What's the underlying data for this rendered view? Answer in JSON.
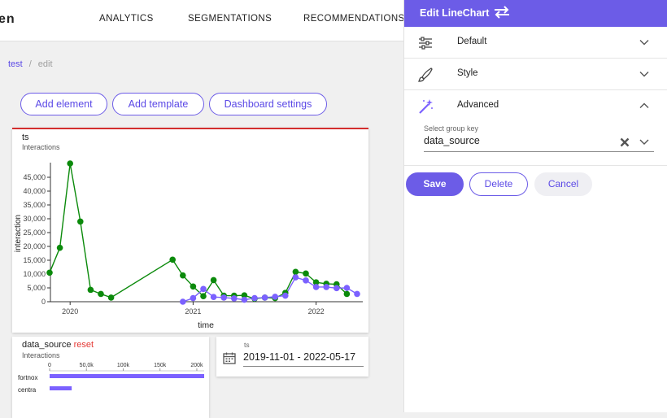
{
  "header": {
    "logo": "en",
    "nav": [
      "ANALYTICS",
      "SEGMENTATIONS",
      "RECOMMENDATIONS"
    ]
  },
  "breadcrumb": {
    "link": "test",
    "sep": "/",
    "current": "edit"
  },
  "toolbar": {
    "add_element": "Add element",
    "add_template": "Add template",
    "dashboard_settings": "Dashboard settings"
  },
  "main_chart": {
    "title": "ts",
    "subtitle": "Interactions",
    "border_color": "#d32f2f",
    "chart_data": {
      "type": "line",
      "xlabel": "time",
      "ylabel": "interaction",
      "ylim": [
        0,
        50000
      ],
      "y_ticks": [
        "0",
        "5,000",
        "10,000",
        "15,000",
        "20,000",
        "25,000",
        "30,000",
        "35,000",
        "40,000",
        "45,000"
      ],
      "x_ticks": [
        {
          "label": "2020",
          "x": "2020-01"
        },
        {
          "label": "2021",
          "x": "2021-01"
        },
        {
          "label": "2022",
          "x": "2022-01"
        }
      ],
      "series": [
        {
          "color": "#0b8a0b",
          "points": [
            [
              "2019-11",
              10500
            ],
            [
              "2019-12",
              19500
            ],
            [
              "2020-01",
              50000
            ],
            [
              "2020-02",
              29000
            ],
            [
              "2020-03",
              4300
            ],
            [
              "2020-04",
              2800
            ],
            [
              "2020-05",
              1500
            ],
            [
              "2020-11",
              15200
            ],
            [
              "2020-12",
              9500
            ],
            [
              "2021-01",
              5500
            ],
            [
              "2021-02",
              2000
            ],
            [
              "2021-03",
              7800
            ],
            [
              "2021-04",
              2200
            ],
            [
              "2021-05",
              2200
            ],
            [
              "2021-06",
              2300
            ],
            [
              "2021-07",
              1100
            ],
            [
              "2021-08",
              1500
            ],
            [
              "2021-09",
              1300
            ],
            [
              "2021-10",
              3200
            ],
            [
              "2021-11",
              10800
            ],
            [
              "2021-12",
              10200
            ],
            [
              "2022-01",
              7000
            ],
            [
              "2022-02",
              6500
            ],
            [
              "2022-03",
              6300
            ],
            [
              "2022-04",
              2800
            ]
          ]
        },
        {
          "color": "#7b61ff",
          "points": [
            [
              "2020-12",
              0
            ],
            [
              "2021-01",
              1300
            ],
            [
              "2021-02",
              4600
            ],
            [
              "2021-03",
              1700
            ],
            [
              "2021-04",
              1500
            ],
            [
              "2021-05",
              1200
            ],
            [
              "2021-06",
              700
            ],
            [
              "2021-07",
              1300
            ],
            [
              "2021-08",
              1500
            ],
            [
              "2021-09",
              1800
            ],
            [
              "2021-10",
              2200
            ],
            [
              "2021-11",
              8800
            ],
            [
              "2021-12",
              7700
            ],
            [
              "2022-01",
              5300
            ],
            [
              "2022-02",
              5300
            ],
            [
              "2022-03",
              4900
            ],
            [
              "2022-04",
              5000
            ],
            [
              "2022-05",
              2800
            ]
          ]
        }
      ]
    }
  },
  "bar_chart": {
    "title": "data_source",
    "reset": "reset",
    "subtitle": "Interactions",
    "chart_data": {
      "type": "bar",
      "orientation": "horizontal",
      "x_ticks": [
        "0",
        "50,0k",
        "100k",
        "150k",
        "200k"
      ],
      "xlim": [
        0,
        210000
      ],
      "categories": [
        "fortnox",
        "centra"
      ],
      "values": [
        210000,
        30000
      ],
      "color": "#7b61ff"
    }
  },
  "date_filter": {
    "label": "ts",
    "value": "2019-11-01 - 2022-05-17"
  },
  "panel": {
    "title": "Edit LineChart",
    "accent": "#6c5ce7",
    "sections": [
      {
        "label": "Default",
        "icon": "sliders-icon",
        "expanded": false
      },
      {
        "label": "Style",
        "icon": "brush-icon",
        "expanded": false
      },
      {
        "label": "Advanced",
        "icon": "magic-wand-icon",
        "expanded": true
      }
    ],
    "group_key": {
      "label": "Select group key",
      "value": "data_source"
    },
    "buttons": {
      "save": "Save",
      "delete": "Delete",
      "cancel": "Cancel"
    }
  }
}
